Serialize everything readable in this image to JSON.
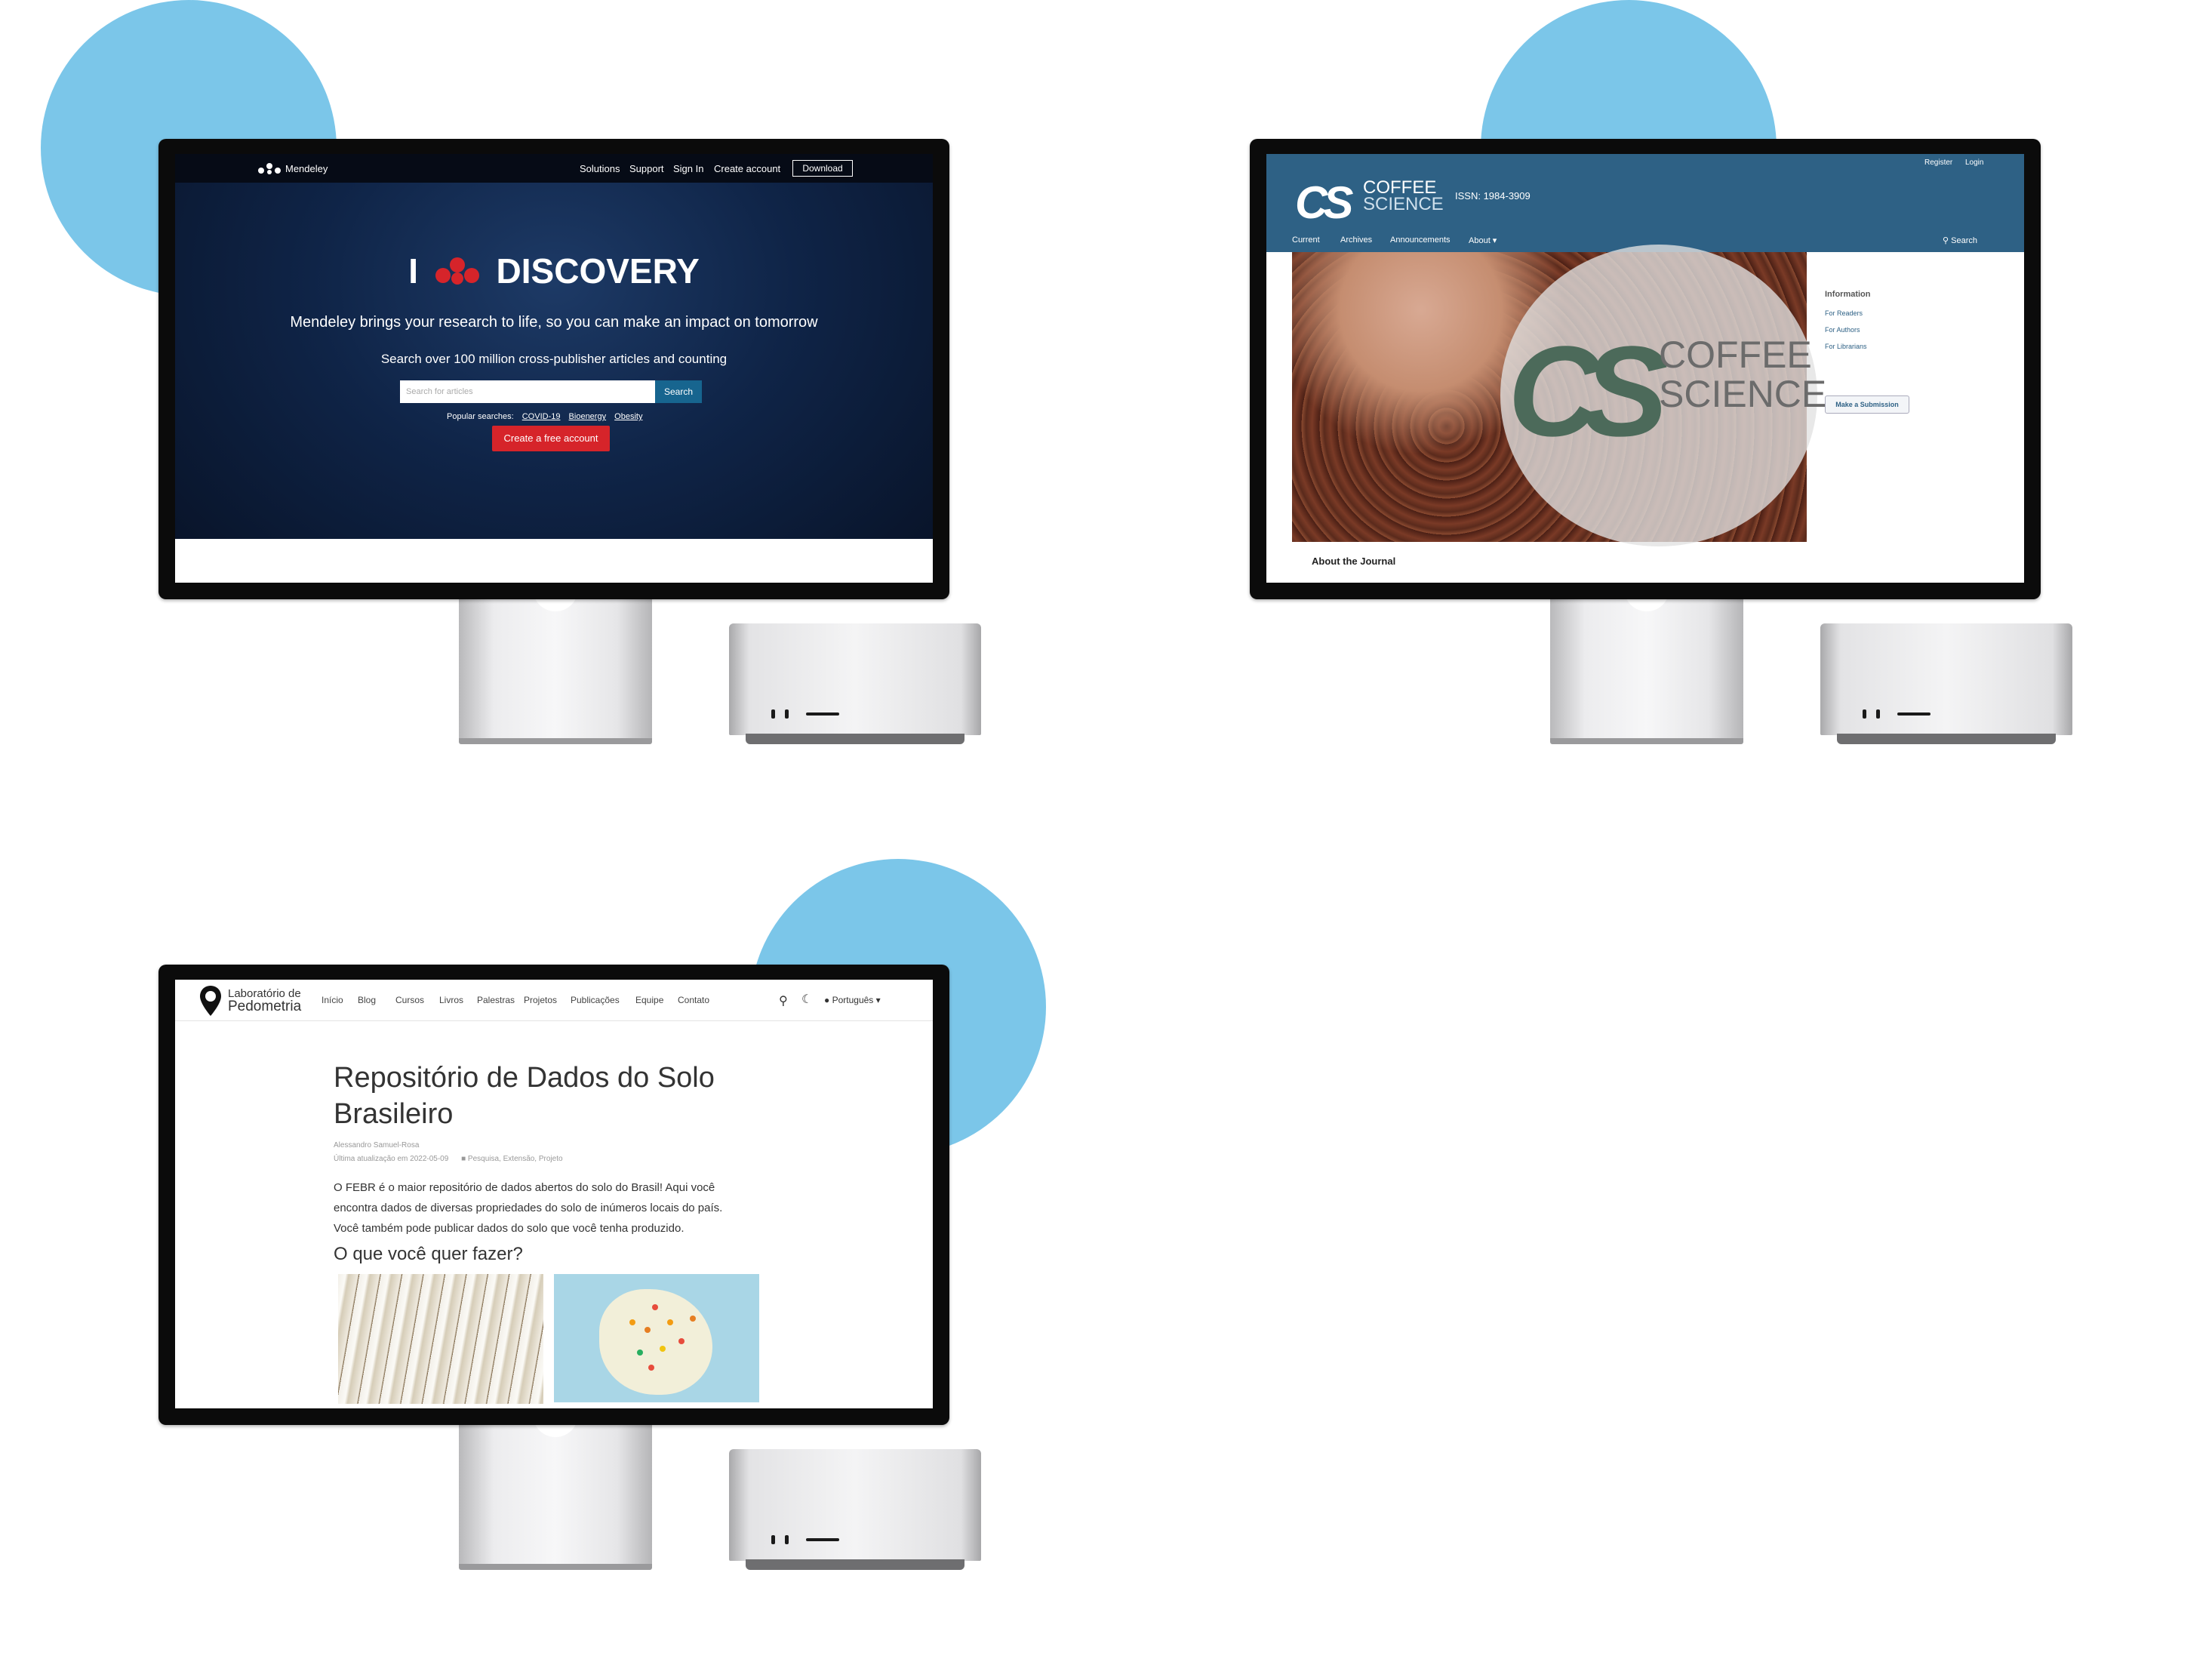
{
  "mendeley": {
    "brand": "Mendeley",
    "nav": [
      "Solutions",
      "Support",
      "Sign In",
      "Create account"
    ],
    "download": "Download",
    "hero_i": "I",
    "hero_word": "DISCOVERY",
    "tagline": "Mendeley brings your research to life, so you can make an impact on tomorrow",
    "search_heading": "Search over 100 million cross-publisher articles and counting",
    "search_placeholder": "Search for articles",
    "search_button": "Search",
    "popular_label": "Popular searches:",
    "popular": [
      "COVID-19",
      "Bioenergy",
      "Obesity"
    ],
    "cta": "Create a free account"
  },
  "coffee": {
    "logo_mark": "CS",
    "logo_top": "COFFEE",
    "logo_bottom": "SCIENCE",
    "issn": "ISSN: 1984-3909",
    "top_links": [
      "Register",
      "Login"
    ],
    "nav": [
      "Current",
      "Archives",
      "Announcements",
      "About ▾"
    ],
    "search": "Search",
    "sidebar_title": "Information",
    "sidebar_links": [
      "For Readers",
      "For Authors",
      "For Librarians"
    ],
    "submission": "Make a Submission",
    "about": "About the Journal",
    "hero_logo_top": "COFFEE",
    "hero_logo_bottom": "SCIENCE"
  },
  "pedometria": {
    "brand_top": "Laboratório de",
    "brand_bottom": "Pedometria",
    "nav": [
      "Início",
      "Blog",
      "Cursos",
      "Livros",
      "Palestras",
      "Projetos",
      "Publicações",
      "Equipe",
      "Contato"
    ],
    "language": "Português ▾",
    "title_line1": "Repositório de Dados do Solo",
    "title_line2": "Brasileiro",
    "author": "Alessandro Samuel-Rosa",
    "updated": "Última atualização em 2022-05-09",
    "categories": "Pesquisa, Extensão, Projeto",
    "body_line1": "O FEBR é o maior repositório de dados abertos do solo do Brasil! Aqui você",
    "body_line2": "encontra dados de diversas propriedades do solo de inúmeros locais do país.",
    "body_line3": "Você também pode publicar dados do solo que você tenha produzido.",
    "subheading": "O que você quer fazer?"
  },
  "colors": {
    "circle": "#7bc6e9",
    "mendeley_red": "#d6242a",
    "coffee_header": "#2e6185"
  }
}
